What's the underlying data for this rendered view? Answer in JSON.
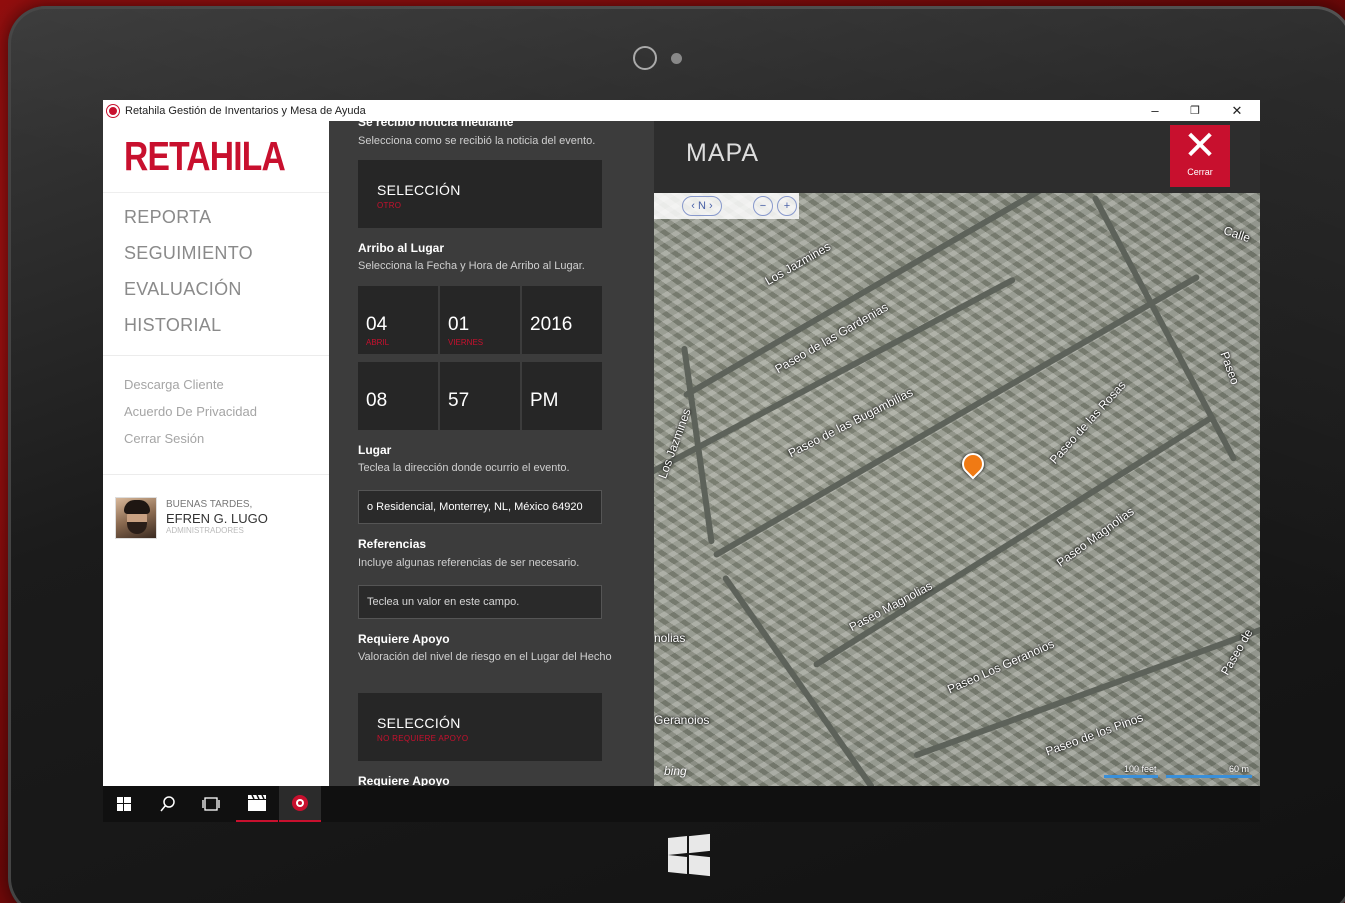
{
  "window": {
    "title": "Retahila Gestión de Inventarios y Mesa de Ayuda",
    "minimize": "–",
    "maximize": "❐",
    "close": "✕"
  },
  "sidebar": {
    "logo": "RETAHILA",
    "nav": [
      "REPORTA",
      "SEGUIMIENTO",
      "EVALUACIÓN",
      "HISTORIAL"
    ],
    "links": [
      "Descarga Cliente",
      "Acuerdo De Privacidad",
      "Cerrar Sesión"
    ],
    "user": {
      "greeting": "BUENAS TARDES,",
      "name": "EFREN G. LUGO",
      "role": "ADMINISTRADORES"
    }
  },
  "form": {
    "section1": {
      "title": "Se recibió noticia mediante",
      "desc": "Selecciona como se recibió la noticia del evento.",
      "select_label": "SELECCIÓN",
      "select_value": "OTRO"
    },
    "arrival": {
      "title": "Arribo al Lugar",
      "desc": "Selecciona la Fecha y Hora de Arribo al Lugar.",
      "day": "04",
      "day_sub": "ABRIL",
      "date": "01",
      "date_sub": "VIERNES",
      "year": "2016",
      "hour": "08",
      "minute": "57",
      "ampm": "PM"
    },
    "place": {
      "title": "Lugar",
      "desc": "Teclea la dirección donde ocurrio el evento.",
      "value": "o Residencial, Monterrey, NL, México 64920"
    },
    "refs": {
      "title": "Referencias",
      "desc": "Incluye algunas referencias de ser necesario.",
      "placeholder": "Teclea un valor en este campo."
    },
    "support": {
      "title": "Requiere Apoyo",
      "desc": "Valoración del nivel de riesgo en el Lugar del Hecho",
      "select_label": "SELECCIÓN",
      "select_value": "NO REQUIERE APOYO"
    },
    "support2": {
      "title": "Requiere Apoyo"
    }
  },
  "map": {
    "title": "MAPA",
    "close_label": "Cerrar",
    "streets": [
      "Los Jazmines",
      "Paseo de las Gardenias",
      "Paseo de las Bugambilias",
      "Paseo de las Rosas",
      "Los Jazmines",
      "Paseo Magnolias",
      "Paseo Magnolias",
      "Paseo Los Geranoios",
      "Paseo de los Pinos",
      "Geranoios",
      "nolias",
      "Calle",
      "Paseo",
      "Paseo de"
    ],
    "brand": "bing",
    "scale_ft": "100 feet",
    "scale_m": "60 m",
    "nav_n": "N"
  },
  "taskbar": {
    "start_icon": "windows-icon",
    "search_icon": "search-icon",
    "taskview_icon": "taskview-icon",
    "app1_icon": "clapperboard-icon",
    "app2_icon": "retahila-app-icon"
  },
  "colors": {
    "accent": "#c8102e",
    "pin": "#f07a14"
  }
}
